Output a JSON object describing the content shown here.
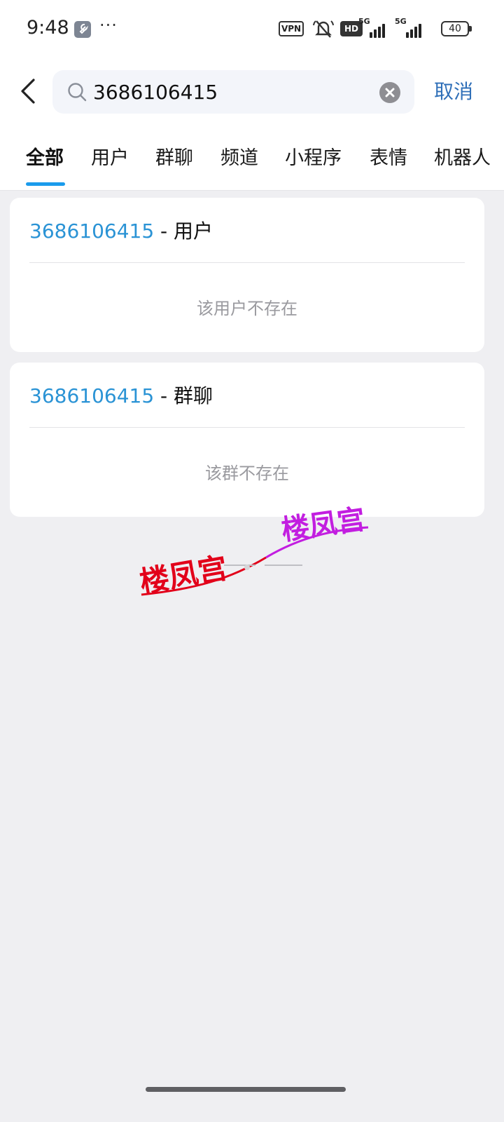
{
  "status_bar": {
    "time": "9:48",
    "dots": "···",
    "vpn": "VPN",
    "hd": "HD",
    "sim1": "5G",
    "sim2": "5G",
    "battery": "40"
  },
  "search": {
    "query": "3686106415",
    "cancel_label": "取消"
  },
  "tabs": [
    {
      "label": "全部",
      "active": true
    },
    {
      "label": "用户",
      "active": false
    },
    {
      "label": "群聊",
      "active": false
    },
    {
      "label": "频道",
      "active": false
    },
    {
      "label": "小程序",
      "active": false
    },
    {
      "label": "表情",
      "active": false
    },
    {
      "label": "机器人",
      "active": false
    }
  ],
  "results": [
    {
      "id": "3686106415",
      "type": " - 用户",
      "empty_text": "该用户不存在"
    },
    {
      "id": "3686106415",
      "type": " - 群聊",
      "empty_text": "该群不存在"
    }
  ],
  "watermark": {
    "text": "楼凤宫"
  },
  "colors": {
    "accent": "#1a9bec",
    "link": "#2a93d5",
    "cancel": "#2f6fb8",
    "background": "#efeff2",
    "watermark_red": "#e2001a",
    "watermark_purple": "#c21ee0"
  }
}
